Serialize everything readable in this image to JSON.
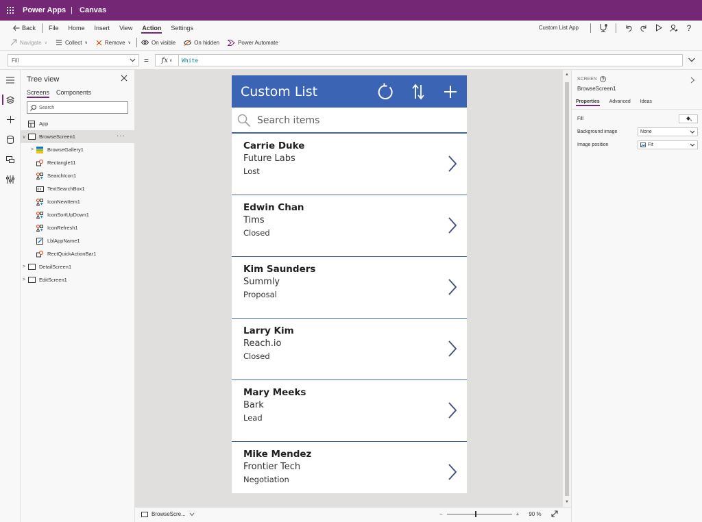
{
  "titlebar": {
    "product": "Power Apps",
    "separator": "|",
    "app_type": "Canvas"
  },
  "menubar": {
    "back": "Back",
    "items": [
      "File",
      "Home",
      "Insert",
      "View",
      "Action",
      "Settings"
    ],
    "active": "Action",
    "app_name": "Custom List App"
  },
  "commandbar": {
    "navigate": "Navigate",
    "collect": "Collect",
    "remove": "Remove",
    "on_visible": "On visible",
    "on_hidden": "On hidden",
    "power_automate": "Power Automate"
  },
  "formula": {
    "property": "Fill",
    "equals": "=",
    "fx": "fx",
    "value": "White"
  },
  "tree": {
    "title": "Tree view",
    "tabs": [
      "Screens",
      "Components"
    ],
    "search_placeholder": "Search",
    "app_label": "App",
    "nodes": [
      {
        "label": "BrowseScreen1",
        "icon": "screen-icon"
      },
      {
        "label": "BrowseGallery1",
        "icon": "gallery-icon"
      },
      {
        "label": "Rectangle11",
        "icon": "shape-icon"
      },
      {
        "label": "SearchIcon1",
        "icon": "icon-control-icon"
      },
      {
        "label": "TextSearchBox1",
        "icon": "text-input-icon"
      },
      {
        "label": "IconNewItem1",
        "icon": "icon-control-icon"
      },
      {
        "label": "IconSortUpDown1",
        "icon": "icon-control-icon"
      },
      {
        "label": "IconRefresh1",
        "icon": "icon-control-icon"
      },
      {
        "label": "LblAppName1",
        "icon": "label-icon"
      },
      {
        "label": "RectQuickActionBar1",
        "icon": "shape-icon"
      },
      {
        "label": "DetailScreen1",
        "icon": "screen-icon"
      },
      {
        "label": "EditScreen1",
        "icon": "screen-icon"
      }
    ]
  },
  "app": {
    "title": "Custom List",
    "search_placeholder": "Search items",
    "header_color": "#3c64b4",
    "items": [
      {
        "name": "Carrie Duke",
        "company": "Future Labs",
        "status": "Lost"
      },
      {
        "name": "Edwin Chan",
        "company": "Tims",
        "status": "Closed"
      },
      {
        "name": "Kim Saunders",
        "company": "Summly",
        "status": "Proposal"
      },
      {
        "name": "Larry Kim",
        "company": "Reach.io",
        "status": "Closed"
      },
      {
        "name": "Mary Meeks",
        "company": "Bark",
        "status": "Lead"
      },
      {
        "name": "Mike Mendez",
        "company": "Frontier Tech",
        "status": "Negotiation"
      }
    ]
  },
  "statusbar": {
    "screen": "BrowseScre...",
    "zoom_minus": "−",
    "zoom_plus": "+",
    "zoom": "90 %"
  },
  "properties": {
    "kind": "SCREEN",
    "name": "BrowseScreen1",
    "tabs": [
      "Properties",
      "Advanced",
      "Ideas"
    ],
    "fill_label": "Fill",
    "background_image_label": "Background image",
    "background_image_value": "None",
    "image_position_label": "Image position",
    "image_position_value": "Fit"
  },
  "colors": {
    "brand": "#742774",
    "accent": "#3c64b4"
  }
}
